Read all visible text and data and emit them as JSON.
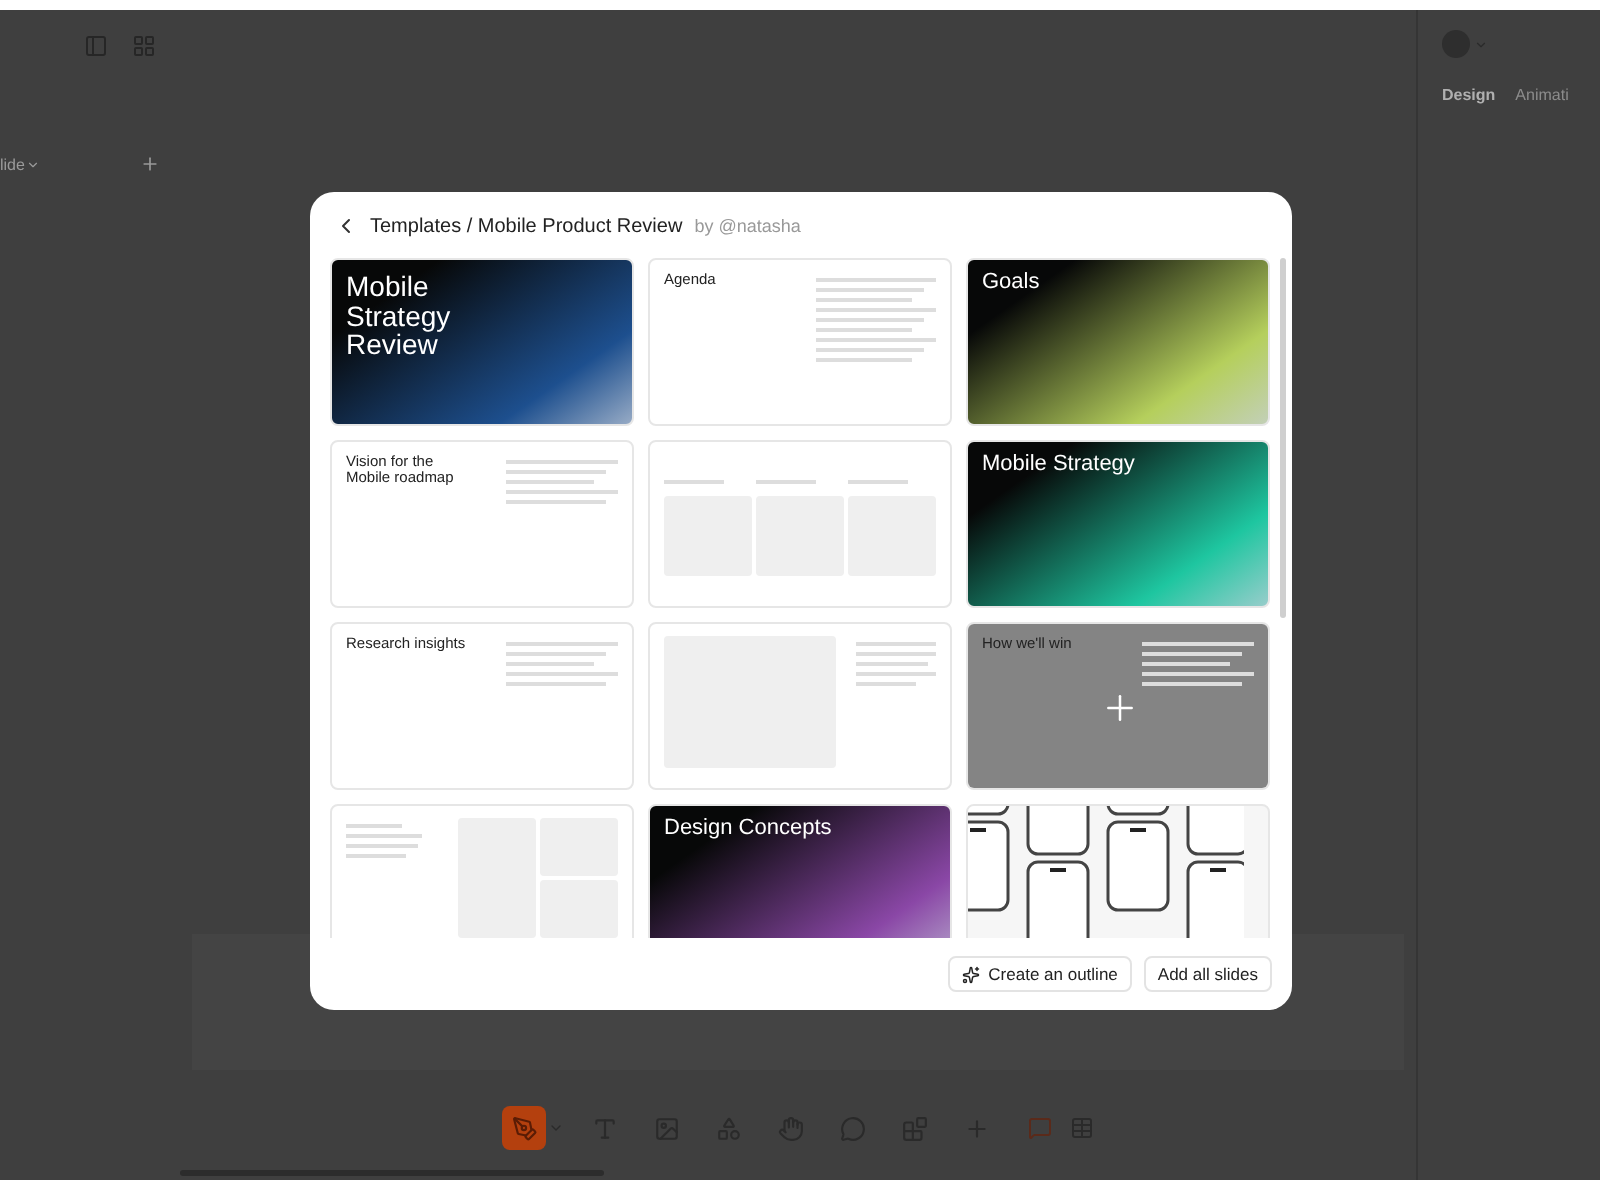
{
  "left_panel": {
    "slide_menu": "lide"
  },
  "right_panel": {
    "tabs": [
      {
        "label": "Design",
        "selected": true
      },
      {
        "label": "Animati",
        "selected": false
      }
    ]
  },
  "toolbar": {
    "tools": [
      {
        "kind": "pen",
        "selected": true
      },
      {
        "kind": "text",
        "selected": false
      },
      {
        "kind": "image",
        "selected": false
      },
      {
        "kind": "shapes",
        "selected": false
      },
      {
        "kind": "stamp",
        "selected": false
      },
      {
        "kind": "comment",
        "selected": false
      },
      {
        "kind": "widgets",
        "selected": false
      },
      {
        "kind": "plus",
        "selected": false
      }
    ]
  },
  "modal": {
    "path": "Templates / Mobile Product Review",
    "author": "by @natasha",
    "slides": [
      {
        "kind": "cover",
        "color": "#1d4f8e",
        "title": "Mobile Strategy Review",
        "hovered": false
      },
      {
        "kind": "agenda",
        "title": "Agenda",
        "hovered": false
      },
      {
        "kind": "cover",
        "color": "#b5cf5c",
        "title": "Goals",
        "hovered": false
      },
      {
        "kind": "text",
        "title": "Vision for the Mobile roadmap",
        "hovered": false
      },
      {
        "kind": "columns",
        "hovered": false
      },
      {
        "kind": "cover",
        "color": "#1ec6a0",
        "title": "Mobile Strategy",
        "hovered": false
      },
      {
        "kind": "text",
        "title": "Research insights",
        "hovered": false
      },
      {
        "kind": "image-text",
        "hovered": false
      },
      {
        "kind": "text",
        "title": "How we'll win",
        "hovered": true
      },
      {
        "kind": "grid",
        "hovered": false
      },
      {
        "kind": "cover",
        "color": "#8a47a6",
        "title": "Design Concepts",
        "hovered": false
      },
      {
        "kind": "phones",
        "hovered": false
      }
    ],
    "buttons": [
      {
        "kind": "outline",
        "label": "Create an outline"
      },
      {
        "kind": "plain",
        "label": "Add all slides"
      }
    ]
  }
}
